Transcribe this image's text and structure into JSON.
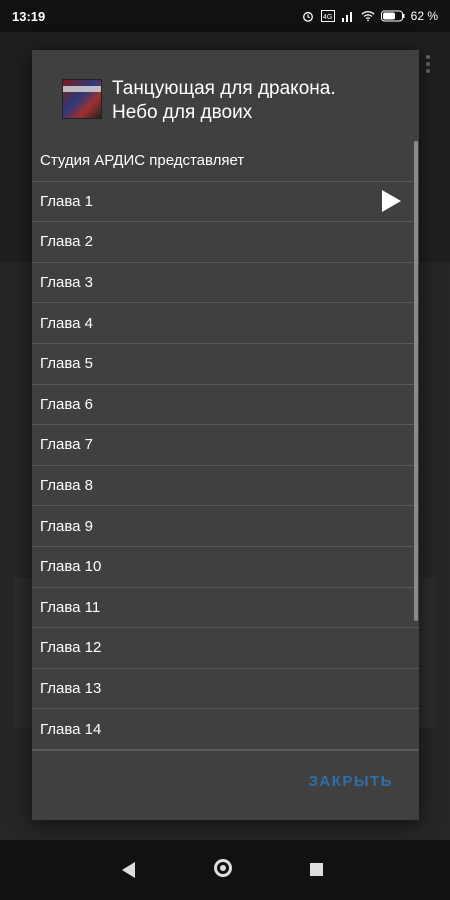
{
  "status_bar": {
    "time": "13:19",
    "battery": "62 %",
    "icons": [
      "alarm-icon",
      "volte-icon",
      "signal-icon",
      "wifi-icon",
      "battery-icon"
    ]
  },
  "dialog": {
    "title_line1": "Танцующая для дракона.",
    "title_line2": "Небо для двоих",
    "cover_icon": "book-cover-thumbnail",
    "header_item": "Студия АРДИС представляет",
    "chapters": [
      "Глава 1",
      "Глава 2",
      "Глава 3",
      "Глава 4",
      "Глава 5",
      "Глава 6",
      "Глава 7",
      "Глава 8",
      "Глава 9",
      "Глава 10",
      "Глава 11",
      "Глава 12",
      "Глава 13",
      "Глава 14"
    ],
    "playing_index": 0,
    "close_label": "ЗАКРЫТЬ",
    "accent_color": "#2f6fa8"
  },
  "nav_bar": {
    "icons": [
      "back-icon",
      "home-icon",
      "recents-icon"
    ]
  }
}
